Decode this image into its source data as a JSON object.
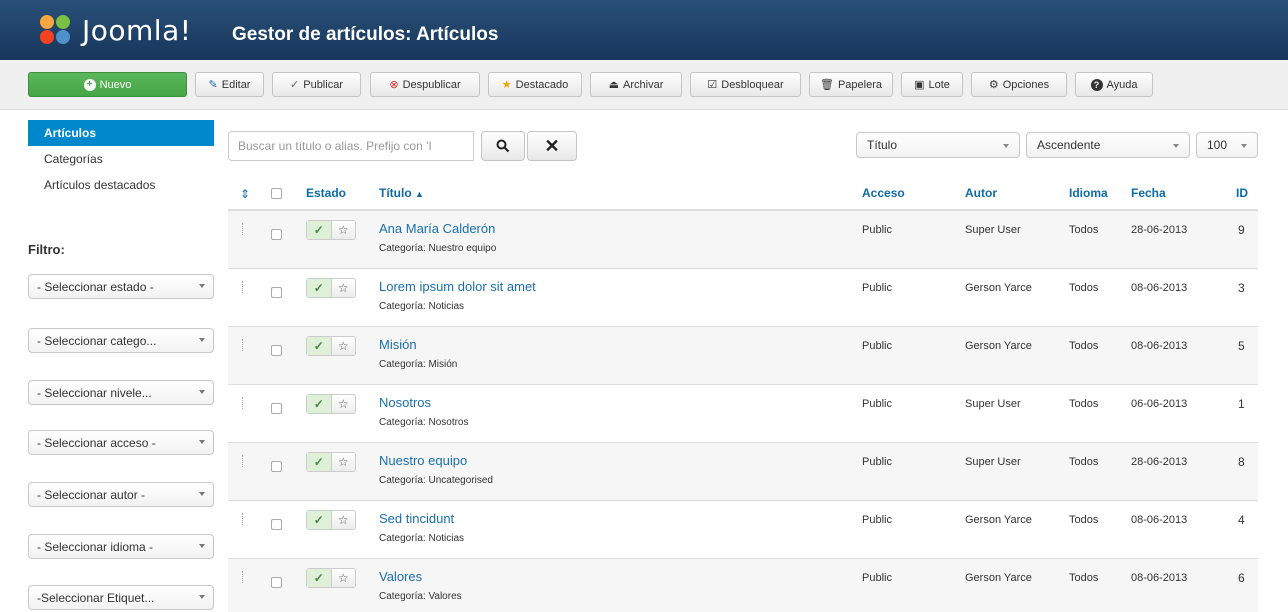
{
  "header": {
    "logo_text": "Joomla!",
    "title": "Gestor de artículos: Artículos"
  },
  "toolbar": {
    "new": "Nuevo",
    "edit": "Editar",
    "publish": "Publicar",
    "unpublish": "Despublicar",
    "featured": "Destacado",
    "archive": "Archivar",
    "checkin": "Desbloquear",
    "trash": "Papelera",
    "batch": "Lote",
    "options": "Opciones",
    "help": "Ayuda"
  },
  "sidebar": {
    "items": [
      {
        "label": "Artículos",
        "active": true
      },
      {
        "label": "Categorías",
        "active": false
      },
      {
        "label": "Artículos destacados",
        "active": false
      }
    ],
    "filter_title": "Filtro:",
    "filters": [
      "- Seleccionar estado -",
      "- Seleccionar catego...",
      "- Seleccionar nivele...",
      "- Seleccionar acceso -",
      "- Seleccionar autor -",
      "- Seleccionar idioma -",
      "-Seleccionar Etiquet..."
    ]
  },
  "search": {
    "placeholder": "Buscar un título o alias. Prefijo con 'I"
  },
  "sort": {
    "field": "Título",
    "direction": "Ascendente",
    "limit": "100"
  },
  "table": {
    "headers": {
      "state": "Estado",
      "title": "Título",
      "access": "Acceso",
      "author": "Autor",
      "language": "Idioma",
      "date": "Fecha",
      "id": "ID"
    },
    "rows": [
      {
        "title": "Ana María Calderón",
        "category": "Categoría: Nuestro equipo",
        "access": "Public",
        "author": "Super User",
        "language": "Todos",
        "date": "28-06-2013",
        "id": "9"
      },
      {
        "title": "Lorem ipsum dolor sit amet",
        "category": "Categoría: Noticias",
        "access": "Public",
        "author": "Gerson Yarce",
        "language": "Todos",
        "date": "08-06-2013",
        "id": "3"
      },
      {
        "title": "Misión",
        "category": "Categoría: Misión",
        "access": "Public",
        "author": "Gerson Yarce",
        "language": "Todos",
        "date": "08-06-2013",
        "id": "5"
      },
      {
        "title": "Nosotros",
        "category": "Categoría: Nosotros",
        "access": "Public",
        "author": "Super User",
        "language": "Todos",
        "date": "06-06-2013",
        "id": "1"
      },
      {
        "title": "Nuestro equipo",
        "category": "Categoría: Uncategorised",
        "access": "Public",
        "author": "Super User",
        "language": "Todos",
        "date": "28-06-2013",
        "id": "8"
      },
      {
        "title": "Sed tincidunt",
        "category": "Categoría: Noticias",
        "access": "Public",
        "author": "Gerson Yarce",
        "language": "Todos",
        "date": "08-06-2013",
        "id": "4"
      },
      {
        "title": "Valores",
        "category": "Categoría: Valores",
        "access": "Public",
        "author": "Gerson Yarce",
        "language": "Todos",
        "date": "08-06-2013",
        "id": "6"
      }
    ]
  },
  "colors": {
    "header_bg": "#17365b",
    "accent": "#0088cc",
    "new_button": "#46a546",
    "link": "#1a6eb0"
  }
}
